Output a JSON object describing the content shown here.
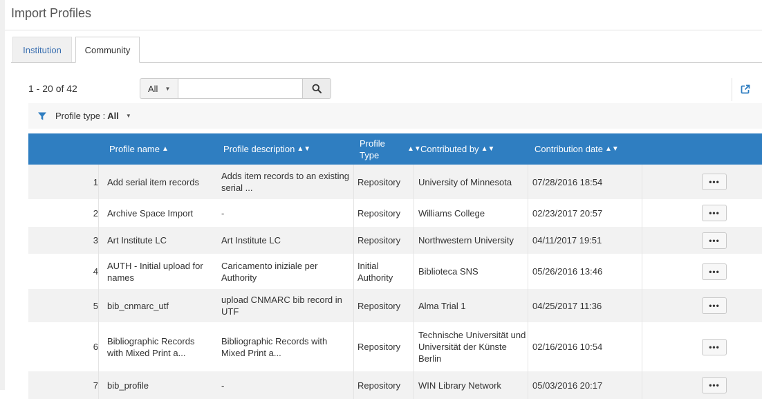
{
  "page": {
    "title": "Import Profiles"
  },
  "tabs": [
    {
      "label": "Institution",
      "active": false
    },
    {
      "label": "Community",
      "active": true
    }
  ],
  "results": {
    "count_label": "1 - 20 of 42"
  },
  "search": {
    "scope": "All",
    "value": "",
    "placeholder": ""
  },
  "filter": {
    "label": "Profile type :",
    "value": "All"
  },
  "table": {
    "columns": [
      {
        "key": "name",
        "label": "Profile name",
        "sort": "▲"
      },
      {
        "key": "description",
        "label": "Profile description",
        "sort": "▲▼"
      },
      {
        "key": "type",
        "label": "Profile Type",
        "sort": "▲▼"
      },
      {
        "key": "contributed_by",
        "label": "Contributed by",
        "sort": "▲▼"
      },
      {
        "key": "date",
        "label": "Contribution date",
        "sort": "▲▼"
      }
    ],
    "rows": [
      {
        "num": "1",
        "name": "Add serial item records",
        "description": "Adds item records to an existing serial ...",
        "type": "Repository",
        "contributed_by": "University of Minnesota",
        "date": "07/28/2016 18:54"
      },
      {
        "num": "2",
        "name": "Archive Space Import",
        "description": "-",
        "type": "Repository",
        "contributed_by": "Williams College",
        "date": "02/23/2017 20:57"
      },
      {
        "num": "3",
        "name": "Art Institute LC",
        "description": "Art Institute LC",
        "type": "Repository",
        "contributed_by": "Northwestern University",
        "date": "04/11/2017 19:51"
      },
      {
        "num": "4",
        "name": "AUTH - Initial upload for names",
        "description": "Caricamento iniziale per Authority",
        "type": "Initial Authority",
        "contributed_by": "Biblioteca SNS",
        "date": "05/26/2016 13:46"
      },
      {
        "num": "5",
        "name": "bib_cnmarc_utf",
        "description": "upload CNMARC bib record in UTF",
        "type": "Repository",
        "contributed_by": "Alma Trial 1",
        "date": "04/25/2017 11:36"
      },
      {
        "num": "6",
        "name": "Bibliographic Records with Mixed Print a...",
        "description": "Bibliographic Records with Mixed Print a...",
        "type": "Repository",
        "contributed_by": "Technische Universität und Universität der Künste Berlin",
        "date": "02/16/2016 10:54"
      },
      {
        "num": "7",
        "name": "bib_profile",
        "description": "-",
        "type": "Repository",
        "contributed_by": "WIN Library Network",
        "date": "05/03/2016 20:17"
      }
    ],
    "row_action_label": "•••"
  },
  "colors": {
    "header_bg": "#2f7ec1",
    "accent": "#3a6fb0",
    "row_alt": "#f2f2f2"
  }
}
